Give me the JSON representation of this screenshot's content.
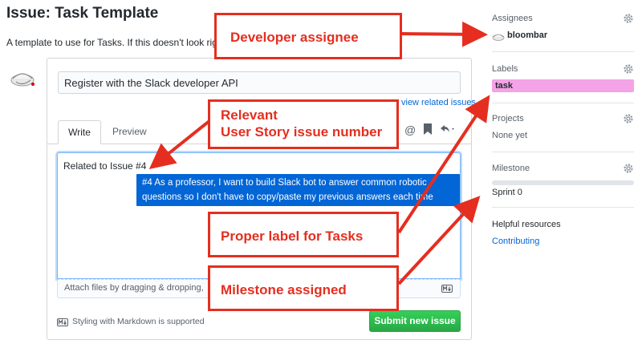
{
  "page": {
    "title": "Issue: Task Template",
    "intro": "A template to use for Tasks. If this doesn't look rig"
  },
  "form": {
    "title_value": "Register with the Slack developer API",
    "related_link": "view related issues",
    "tabs": [
      {
        "label": "Write",
        "active": true
      },
      {
        "label": "Preview",
        "active": false
      }
    ],
    "body_text": "Related to Issue #4",
    "suggestion_line1": "#4 As a professor, I want to build Slack bot to answer common robotic",
    "suggestion_line2": "questions so I don't have to copy/paste my previous answers each time",
    "attach_text": "Attach files by dragging & dropping,",
    "markdown_hint": "Styling with Markdown is supported",
    "submit_label": "Submit new issue"
  },
  "sidebar": {
    "assignees": {
      "heading": "Assignees",
      "user": "bloombar"
    },
    "labels": {
      "heading": "Labels",
      "label": "task",
      "label_color": "#f4a3e6"
    },
    "projects": {
      "heading": "Projects",
      "value": "None yet"
    },
    "milestone": {
      "heading": "Milestone",
      "value": "Sprint 0"
    },
    "helpful": {
      "heading": "Helpful resources",
      "link": "Contributing"
    }
  },
  "callouts": {
    "developer": "Developer assignee",
    "story_line1": "Relevant",
    "story_line2": "User Story issue number",
    "label": "Proper label for Tasks",
    "milestone": "Milestone assigned"
  },
  "colors": {
    "callout": "#e52e1f",
    "link": "#0366d6",
    "submit": "#28a745",
    "suggestion": "#0366d6"
  },
  "icons": [
    "gear-icon",
    "mention-icon",
    "bookmark-icon",
    "reply-icon",
    "markdown-icon",
    "avatar-icon"
  ]
}
